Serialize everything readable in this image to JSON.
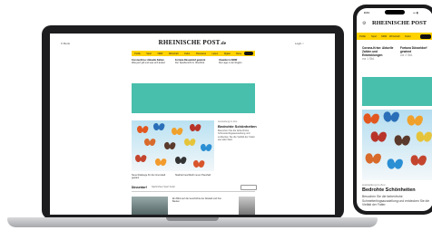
{
  "site": {
    "logo": "RHEINISCHE POST",
    "logo_tld": ".de",
    "menu_label": "≡  Menü",
    "login_label": "Login  ○"
  },
  "desktop": {
    "nav_items": [
      "Politik",
      "Sport",
      "NRW",
      "Wirtschaft",
      "Kultur",
      "Panorama",
      "Leben",
      "Digital",
      "Reise",
      "Auto"
    ],
    "top_columns": [
      {
        "title": "Corona-Krise: Aktuelle Zahlen",
        "text": "Was jetzt gilt und was sich ändert"
      },
      {
        "title": "Fortuna Düsseldorf gewinnt",
        "text": "Der Spielbericht im Überblick"
      },
      {
        "title": "Unwetter in NRW",
        "text": "Die Lage in der Region"
      }
    ],
    "feature": {
      "tag": "Ausstellung im Zoo",
      "title": "Bedrohte Schönheiten",
      "text": "Besuchen Sie die farbenfrohe Schmetterlingsausstellung und entdecken Sie die Vielfalt der Falter aus aller Welt."
    },
    "small_items": [
      "Neue Radwege für die Innenstadt geplant",
      "Stadtrat beschließt neuen Haushalt"
    ],
    "section": {
      "title": "Düsseldorf",
      "links": "Nachrichten  Sport  Kultur",
      "row_text": "Ein Blick auf die Geschichte der Altstadt und ihre Bauten"
    }
  },
  "phone": {
    "time": "9:41",
    "status_right": "••• ▮",
    "nav_items": [
      "Politik",
      "Sport",
      "NRW",
      "Wirtschaft",
      "Kultur"
    ],
    "top_columns": [
      {
        "title": "Corona-Krise: Aktuelle Zahlen und Entwicklungen",
        "meta": "vor 1 Std."
      },
      {
        "title": "Fortuna Düsseldorf gewinnt",
        "meta": "vor 2 Std."
      }
    ],
    "feature": {
      "tag": "Ausstellung im Zoo",
      "title": "Bedrohte Schönheiten",
      "text": "Besuchen Sie die farbenfrohe Schmetterlingsausstellung und entdecken Sie die Vielfalt der Falter."
    }
  },
  "colors": {
    "brand_yellow": "#ffd200",
    "ad_teal": "#47bfac",
    "device_dark": "#1d1d1f"
  }
}
